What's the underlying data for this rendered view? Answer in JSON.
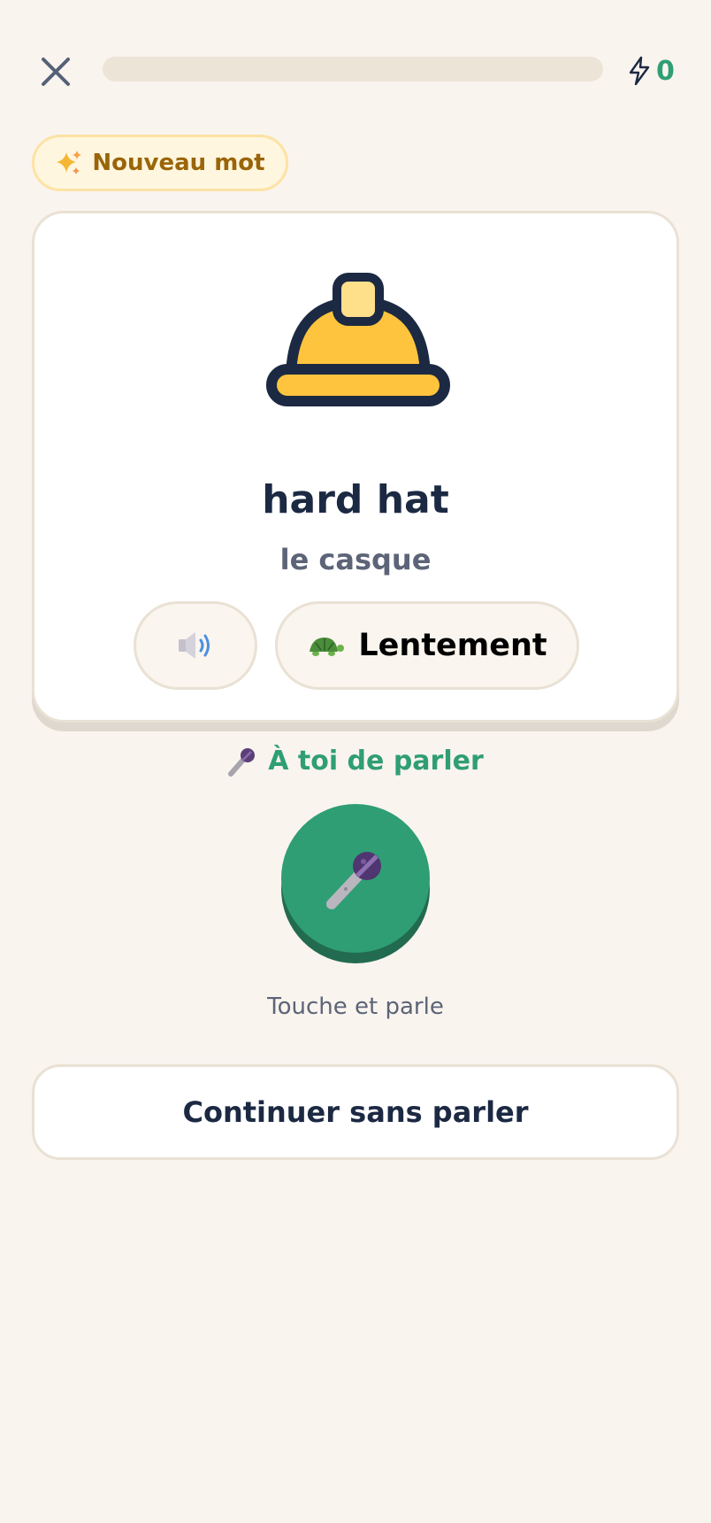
{
  "header": {
    "close_icon": "close-icon",
    "progress": 0,
    "xp_icon": "lightning-icon",
    "xp_count": "0"
  },
  "badge": {
    "icon": "sparkles-icon",
    "label": "Nouveau mot"
  },
  "card": {
    "image_icon": "hard-hat-icon",
    "word": "hard hat",
    "translation": "le casque",
    "audio_icon": "speaker-icon",
    "slow_icon": "turtle-icon",
    "slow_label": "Lentement"
  },
  "speak": {
    "title_icon": "microphone-icon",
    "title": "À toi de parler",
    "mic_icon": "microphone-icon",
    "hint": "Touche et parle"
  },
  "footer": {
    "continue_label": "Continuer sans parler"
  },
  "colors": {
    "background": "#f9f4ee",
    "accent_green": "#2f9e74",
    "badge_text": "#9a6508",
    "hat_yellow": "#ffc43d",
    "navy": "#1c2943"
  }
}
